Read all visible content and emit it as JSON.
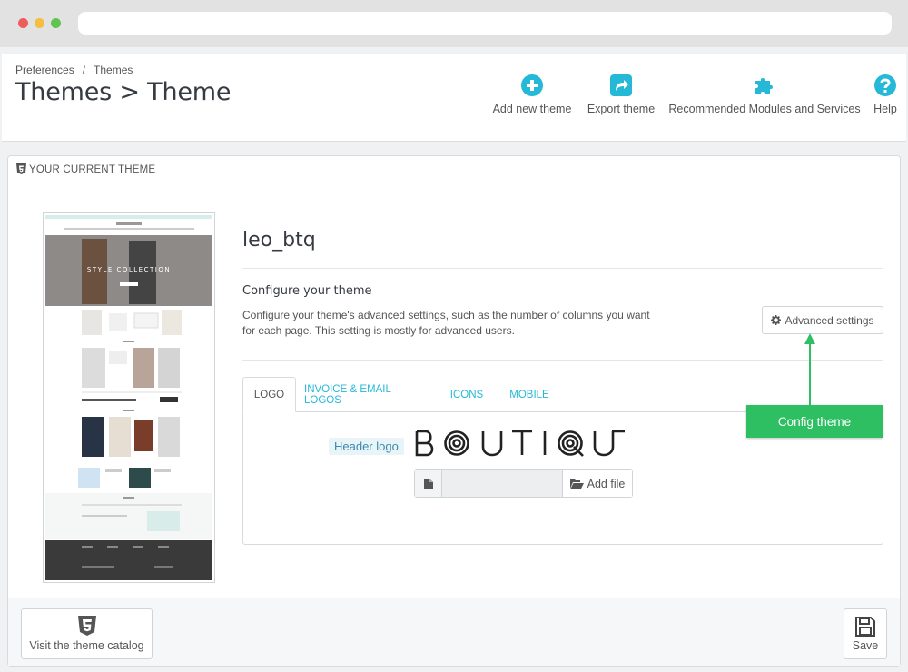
{
  "breadcrumb": {
    "parent": "Preferences",
    "separator": "/",
    "current": "Themes"
  },
  "page_title": "Themes > Theme",
  "toolbar": {
    "add_new_theme": "Add new theme",
    "export_theme": "Export theme",
    "recommended": "Recommended Modules and Services",
    "help": "Help"
  },
  "panel": {
    "heading": "Your current theme",
    "theme_name": "leo_btq",
    "configure_title": "Configure your theme",
    "configure_desc": "Configure your theme's advanced settings, such as the number of columns you want for each page. This setting is mostly for advanced users.",
    "advanced_settings": "Advanced settings"
  },
  "tabs": [
    {
      "label": "Logo",
      "active": true
    },
    {
      "label": "Invoice & Email Logos",
      "active": false
    },
    {
      "label": "Icons",
      "active": false
    },
    {
      "label": "Mobile",
      "active": false
    }
  ],
  "logo": {
    "label": "Header logo",
    "image_text": "BOUTIQUE",
    "add_file": "Add file"
  },
  "callout": "Config theme",
  "preview_banner": "STYLE COLLECTION",
  "footer": {
    "catalog": "Visit the theme catalog",
    "save": "Save"
  },
  "colors": {
    "accent": "#25b9d7",
    "callout": "#2ebf63",
    "text": "#363a41"
  }
}
